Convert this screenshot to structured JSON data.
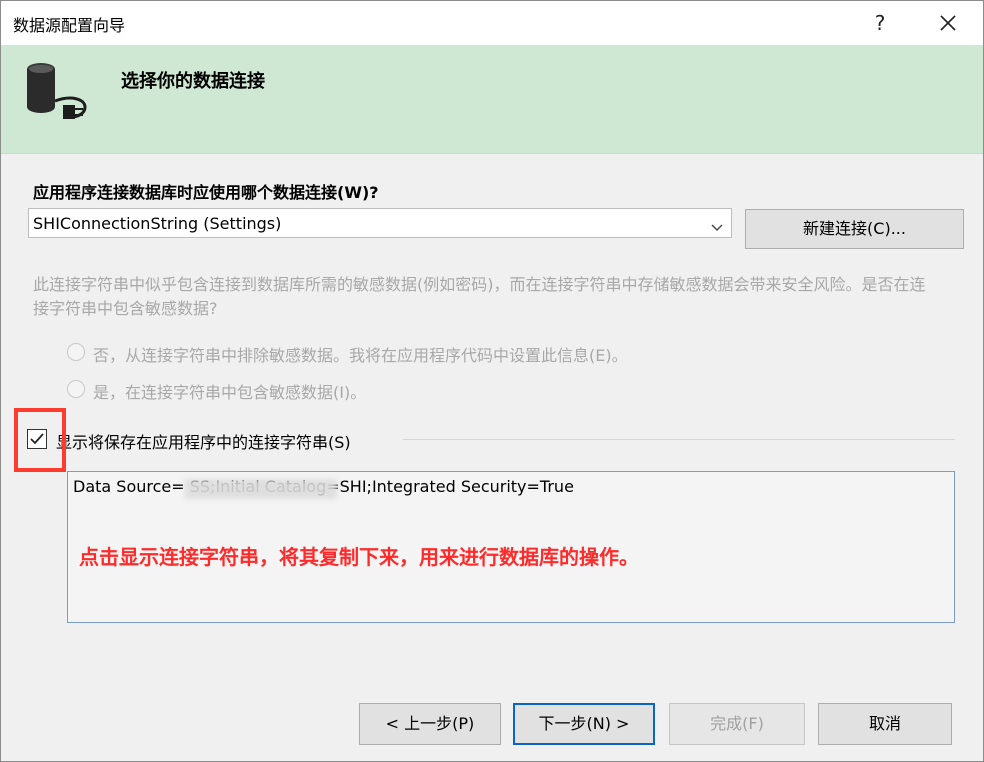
{
  "window": {
    "title": "数据源配置向导",
    "help_label": "?"
  },
  "header": {
    "title": "选择你的数据连接",
    "icon": "database-plug-icon"
  },
  "connection": {
    "question": "应用程序连接数据库时应使用哪个数据连接(W)?",
    "selected": "SHIConnectionString (Settings)",
    "new_button": "新建连接(C)..."
  },
  "sensitive": {
    "warning": "此连接字符串中似乎包含连接到数据库所需的敏感数据(例如密码)，而在连接字符串中存储敏感数据会带来安全风险。是否在连接字符串中包含敏感数据?",
    "options": [
      {
        "label": "否，从连接字符串中排除敏感数据。我将在应用程序代码中设置此信息(E)。",
        "checked": false,
        "enabled": false
      },
      {
        "label": "是，在连接字符串中包含敏感数据(I)。",
        "checked": false,
        "enabled": false
      }
    ]
  },
  "show_string": {
    "label": "显示将保存在应用程序中的连接字符串(S)",
    "checked": true,
    "connection_string": "Data Source=               SS;Initial Catalog=SHI;Integrated Security=True",
    "annotation": "点击显示连接字符串，将其复制下来，用来进行数据库的操作。"
  },
  "footer": {
    "prev": "< 上一步(P)",
    "next": "下一步(N) >",
    "finish": "完成(F)",
    "cancel": "取消"
  },
  "colors": {
    "header_bg": "#cfe8d3",
    "annotation": "#ff2a2a",
    "highlight": "#ff3b30",
    "focus": "#0a64c8"
  }
}
